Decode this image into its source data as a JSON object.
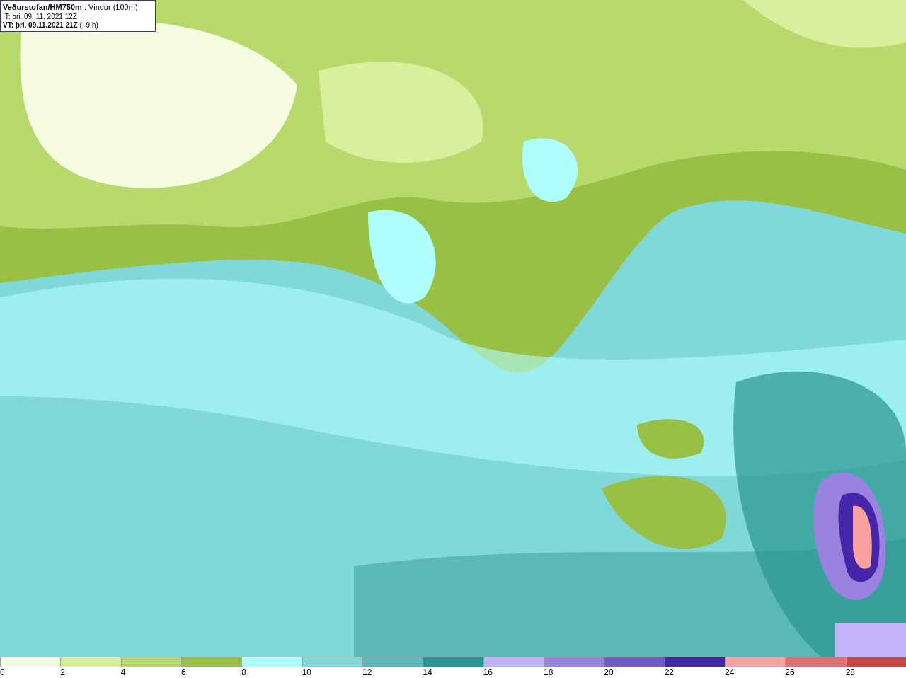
{
  "header": {
    "title": "**Veðurstofan/HM750m** : Vindur (100m)",
    "initial_time": "IT: þri. 09. 11. 2021 12Z",
    "valid_time": "**VT: þri. 09.11.2021 21Z** (+9 h)"
  },
  "legend": {
    "swatches": [
      {
        "color": "#f5fce0"
      },
      {
        "color": "#d8f09c"
      },
      {
        "color": "#b8da6c"
      },
      {
        "color": "#98c044"
      },
      {
        "color": "#b0ffff"
      },
      {
        "color": "#80dada"
      },
      {
        "color": "#5ab8b8"
      },
      {
        "color": "#289590"
      },
      {
        "color": "#c2b2fa"
      },
      {
        "color": "#9a82e0"
      },
      {
        "color": "#7658c6"
      },
      {
        "color": "#4626a8"
      },
      {
        "color": "#faa2a0"
      },
      {
        "color": "#e07070"
      },
      {
        "color": "#c84646"
      }
    ],
    "labels": [
      "0",
      "2",
      "4",
      "6",
      "8",
      "10",
      "12",
      "14",
      "16",
      "18",
      "20",
      "22",
      "24",
      "26",
      "28"
    ]
  }
}
